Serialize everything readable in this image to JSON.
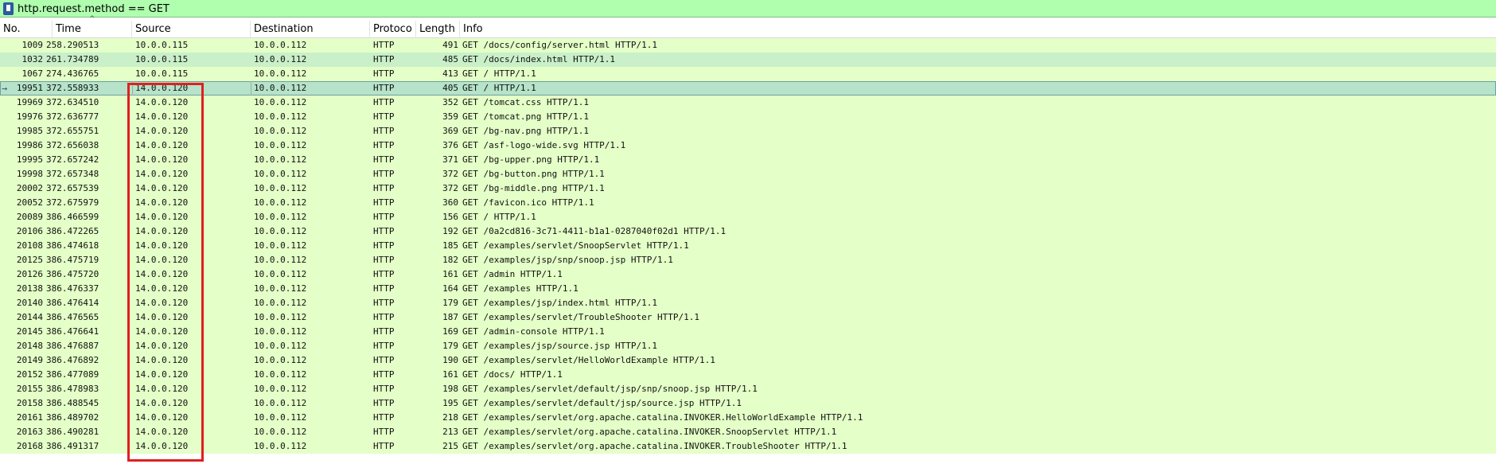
{
  "filter": {
    "value": "http.request.method == GET"
  },
  "columns": {
    "no": "No.",
    "time": "Time",
    "source": "Source",
    "destination": "Destination",
    "protocol": "Protoco",
    "length": "Length",
    "info": "Info"
  },
  "sort_indicator": "^",
  "selected_marker": "→",
  "packets": [
    {
      "no": "1009",
      "time": "258.290513",
      "src": "10.0.0.115",
      "dst": "10.0.0.112",
      "proto": "HTTP",
      "len": "491",
      "info": "GET /docs/config/server.html HTTP/1.1"
    },
    {
      "no": "1032",
      "time": "261.734789",
      "src": "10.0.0.115",
      "dst": "10.0.0.112",
      "proto": "HTTP",
      "len": "485",
      "info": "GET /docs/index.html HTTP/1.1"
    },
    {
      "no": "1067",
      "time": "274.436765",
      "src": "10.0.0.115",
      "dst": "10.0.0.112",
      "proto": "HTTP",
      "len": "413",
      "info": "GET / HTTP/1.1"
    },
    {
      "no": "19951",
      "time": "372.558933",
      "src": "14.0.0.120",
      "dst": "10.0.0.112",
      "proto": "HTTP",
      "len": "405",
      "info": "GET / HTTP/1.1"
    },
    {
      "no": "19969",
      "time": "372.634510",
      "src": "14.0.0.120",
      "dst": "10.0.0.112",
      "proto": "HTTP",
      "len": "352",
      "info": "GET /tomcat.css HTTP/1.1"
    },
    {
      "no": "19976",
      "time": "372.636777",
      "src": "14.0.0.120",
      "dst": "10.0.0.112",
      "proto": "HTTP",
      "len": "359",
      "info": "GET /tomcat.png HTTP/1.1"
    },
    {
      "no": "19985",
      "time": "372.655751",
      "src": "14.0.0.120",
      "dst": "10.0.0.112",
      "proto": "HTTP",
      "len": "369",
      "info": "GET /bg-nav.png HTTP/1.1"
    },
    {
      "no": "19986",
      "time": "372.656038",
      "src": "14.0.0.120",
      "dst": "10.0.0.112",
      "proto": "HTTP",
      "len": "376",
      "info": "GET /asf-logo-wide.svg HTTP/1.1"
    },
    {
      "no": "19995",
      "time": "372.657242",
      "src": "14.0.0.120",
      "dst": "10.0.0.112",
      "proto": "HTTP",
      "len": "371",
      "info": "GET /bg-upper.png HTTP/1.1"
    },
    {
      "no": "19998",
      "time": "372.657348",
      "src": "14.0.0.120",
      "dst": "10.0.0.112",
      "proto": "HTTP",
      "len": "372",
      "info": "GET /bg-button.png HTTP/1.1"
    },
    {
      "no": "20002",
      "time": "372.657539",
      "src": "14.0.0.120",
      "dst": "10.0.0.112",
      "proto": "HTTP",
      "len": "372",
      "info": "GET /bg-middle.png HTTP/1.1"
    },
    {
      "no": "20052",
      "time": "372.675979",
      "src": "14.0.0.120",
      "dst": "10.0.0.112",
      "proto": "HTTP",
      "len": "360",
      "info": "GET /favicon.ico HTTP/1.1"
    },
    {
      "no": "20089",
      "time": "386.466599",
      "src": "14.0.0.120",
      "dst": "10.0.0.112",
      "proto": "HTTP",
      "len": "156",
      "info": "GET / HTTP/1.1"
    },
    {
      "no": "20106",
      "time": "386.472265",
      "src": "14.0.0.120",
      "dst": "10.0.0.112",
      "proto": "HTTP",
      "len": "192",
      "info": "GET /0a2cd816-3c71-4411-b1a1-0287040f02d1 HTTP/1.1"
    },
    {
      "no": "20108",
      "time": "386.474618",
      "src": "14.0.0.120",
      "dst": "10.0.0.112",
      "proto": "HTTP",
      "len": "185",
      "info": "GET /examples/servlet/SnoopServlet HTTP/1.1"
    },
    {
      "no": "20125",
      "time": "386.475719",
      "src": "14.0.0.120",
      "dst": "10.0.0.112",
      "proto": "HTTP",
      "len": "182",
      "info": "GET /examples/jsp/snp/snoop.jsp HTTP/1.1"
    },
    {
      "no": "20126",
      "time": "386.475720",
      "src": "14.0.0.120",
      "dst": "10.0.0.112",
      "proto": "HTTP",
      "len": "161",
      "info": "GET /admin HTTP/1.1"
    },
    {
      "no": "20138",
      "time": "386.476337",
      "src": "14.0.0.120",
      "dst": "10.0.0.112",
      "proto": "HTTP",
      "len": "164",
      "info": "GET /examples HTTP/1.1"
    },
    {
      "no": "20140",
      "time": "386.476414",
      "src": "14.0.0.120",
      "dst": "10.0.0.112",
      "proto": "HTTP",
      "len": "179",
      "info": "GET /examples/jsp/index.html HTTP/1.1"
    },
    {
      "no": "20144",
      "time": "386.476565",
      "src": "14.0.0.120",
      "dst": "10.0.0.112",
      "proto": "HTTP",
      "len": "187",
      "info": "GET /examples/servlet/TroubleShooter HTTP/1.1"
    },
    {
      "no": "20145",
      "time": "386.476641",
      "src": "14.0.0.120",
      "dst": "10.0.0.112",
      "proto": "HTTP",
      "len": "169",
      "info": "GET /admin-console HTTP/1.1"
    },
    {
      "no": "20148",
      "time": "386.476887",
      "src": "14.0.0.120",
      "dst": "10.0.0.112",
      "proto": "HTTP",
      "len": "179",
      "info": "GET /examples/jsp/source.jsp HTTP/1.1"
    },
    {
      "no": "20149",
      "time": "386.476892",
      "src": "14.0.0.120",
      "dst": "10.0.0.112",
      "proto": "HTTP",
      "len": "190",
      "info": "GET /examples/servlet/HelloWorldExample HTTP/1.1"
    },
    {
      "no": "20152",
      "time": "386.477089",
      "src": "14.0.0.120",
      "dst": "10.0.0.112",
      "proto": "HTTP",
      "len": "161",
      "info": "GET /docs/ HTTP/1.1"
    },
    {
      "no": "20155",
      "time": "386.478983",
      "src": "14.0.0.120",
      "dst": "10.0.0.112",
      "proto": "HTTP",
      "len": "198",
      "info": "GET /examples/servlet/default/jsp/snp/snoop.jsp HTTP/1.1"
    },
    {
      "no": "20158",
      "time": "386.488545",
      "src": "14.0.0.120",
      "dst": "10.0.0.112",
      "proto": "HTTP",
      "len": "195",
      "info": "GET /examples/servlet/default/jsp/source.jsp HTTP/1.1"
    },
    {
      "no": "20161",
      "time": "386.489702",
      "src": "14.0.0.120",
      "dst": "10.0.0.112",
      "proto": "HTTP",
      "len": "218",
      "info": "GET /examples/servlet/org.apache.catalina.INVOKER.HelloWorldExample HTTP/1.1"
    },
    {
      "no": "20163",
      "time": "386.490281",
      "src": "14.0.0.120",
      "dst": "10.0.0.112",
      "proto": "HTTP",
      "len": "213",
      "info": "GET /examples/servlet/org.apache.catalina.INVOKER.SnoopServlet HTTP/1.1"
    },
    {
      "no": "20168",
      "time": "386.491317",
      "src": "14.0.0.120",
      "dst": "10.0.0.112",
      "proto": "HTTP",
      "len": "215",
      "info": "GET /examples/servlet/org.apache.catalina.INVOKER.TroubleShooter HTTP/1.1"
    }
  ],
  "colors": {
    "filter_bg": "#afffaf",
    "row_bg": "#e4ffc7",
    "alt_row_bg": "#c9f0c9",
    "selected_bg": "#b6e3c9",
    "highlight_border": "#e02020"
  }
}
